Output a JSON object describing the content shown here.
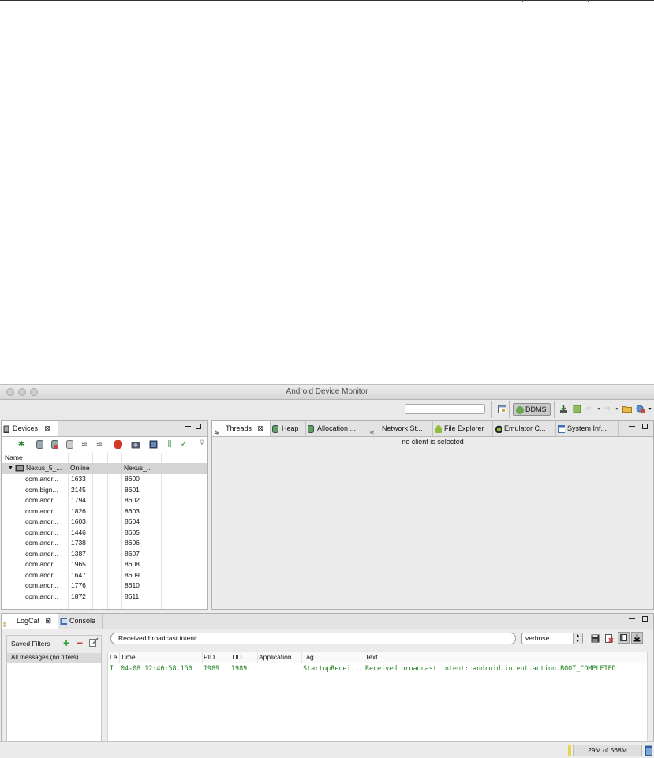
{
  "window": {
    "title": "Android Device Monitor"
  },
  "toolbar": {
    "ddms_label": "DDMS"
  },
  "devices": {
    "tab_label": "Devices",
    "name_header": "Name",
    "device": {
      "name": "Nexus_5_...",
      "status": "Online",
      "serial": "Nexus_..."
    },
    "processes": [
      {
        "name": "com.andr...",
        "pid": "1633",
        "port": "8600"
      },
      {
        "name": "com.bign...",
        "pid": "2145",
        "port": "8601"
      },
      {
        "name": "com.andr...",
        "pid": "1794",
        "port": "8602"
      },
      {
        "name": "com.andr...",
        "pid": "1826",
        "port": "8603"
      },
      {
        "name": "com.andr...",
        "pid": "1603",
        "port": "8604"
      },
      {
        "name": "com.andr...",
        "pid": "1446",
        "port": "8605"
      },
      {
        "name": "com.andr...",
        "pid": "1738",
        "port": "8606"
      },
      {
        "name": "com.andr...",
        "pid": "1387",
        "port": "8607"
      },
      {
        "name": "com.andr...",
        "pid": "1965",
        "port": "8608"
      },
      {
        "name": "com.andr...",
        "pid": "1647",
        "port": "8609"
      },
      {
        "name": "com.andr...",
        "pid": "1776",
        "port": "8610"
      },
      {
        "name": "com.andr...",
        "pid": "1872",
        "port": "8611"
      }
    ]
  },
  "tools": {
    "tabs": [
      {
        "label": "Threads"
      },
      {
        "label": "Heap"
      },
      {
        "label": "Allocation ..."
      },
      {
        "label": "Network St..."
      },
      {
        "label": "File Explorer"
      },
      {
        "label": "Emulator C..."
      },
      {
        "label": "System Inf..."
      }
    ],
    "message": "no client is selected"
  },
  "logcat": {
    "tab_label": "LogCat",
    "console_label": "Console",
    "saved_filters_label": "Saved Filters",
    "all_messages": "All messages (no filters)",
    "search_value": "Received broadcast intent:",
    "level": "verbose",
    "columns": [
      "Le",
      "Time",
      "PID",
      "TID",
      "Application",
      "Tag",
      "Text"
    ],
    "entries": [
      {
        "level": "I",
        "time": "04-08 12:40:58.150",
        "pid": "1989",
        "tid": "1989",
        "app": "",
        "tag": "StartupRecei...",
        "text": "Received broadcast intent: android.intent.action.BOOT_COMPLETED"
      }
    ]
  },
  "status": {
    "memory": "29M of 568M"
  },
  "colors": {
    "log_info": "#1e7f1e",
    "selection": "#d4d4d4"
  }
}
